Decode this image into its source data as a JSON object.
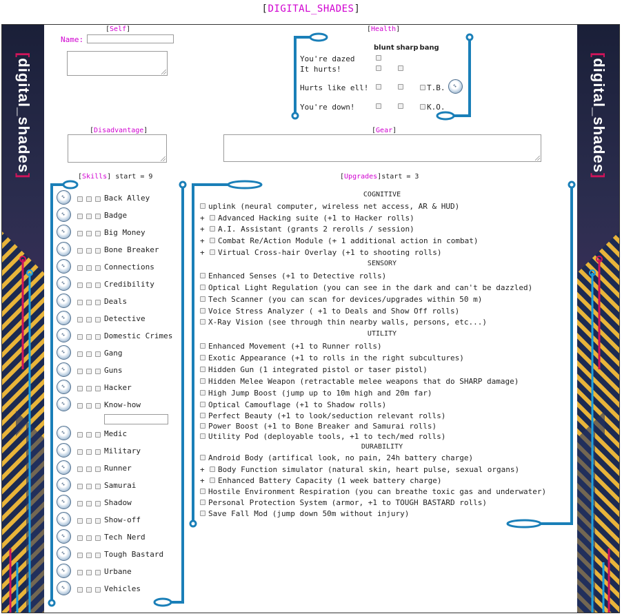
{
  "page_title": {
    "open": "[",
    "name": "DIGITAL_SHADES",
    "close": "]"
  },
  "sidebar_brand": {
    "bracket_open": "[",
    "name": "digital_shades",
    "bracket_close": "]"
  },
  "self": {
    "header": "Self",
    "name_label": "Name:"
  },
  "health": {
    "header": "Health",
    "columns": [
      "blunt",
      "sharp",
      "bang"
    ],
    "rows": [
      "You're dazed",
      "It hurts!",
      "Hurts like ell!",
      "You're down!"
    ],
    "tb_label": "T.B.",
    "ko_label": "K.O."
  },
  "disadvantage": {
    "header": "Disadvantage"
  },
  "gear": {
    "header": "Gear"
  },
  "skills": {
    "header": "Skills",
    "start_text": "start = 9",
    "items": [
      "Back Alley",
      "Badge",
      "Big Money",
      "Bone Breaker",
      "Connections",
      "Credibility",
      "Deals",
      "Detective",
      "Domestic Crimes",
      "Gang",
      "Guns",
      "Hacker",
      "Know-how",
      "Medic",
      "Military",
      "Runner",
      "Samurai",
      "Shadow",
      "Show-off",
      "Tech Nerd",
      "Tough Bastard",
      "Urbane",
      "Vehicles"
    ]
  },
  "upgrades": {
    "header": "Upgrades",
    "start_text": "start = 3",
    "categories": {
      "cognitive": "COGNITIVE",
      "sensory": "SENSORY",
      "utility": "UTILITY",
      "durability": "DURABILITY"
    },
    "plus": "+",
    "cognitive_items": [
      "uplink (neural computer, wireless net access, AR & HUD)",
      "Advanced Hacking suite (+1 to Hacker rolls)",
      "A.I. Assistant (grants 2 rerolls / session)",
      "Combat Re/Action Module (+ 1 additional action in combat)",
      "Virtual Cross-hair Overlay (+1 to shooting rolls)"
    ],
    "sensory_items": [
      "Enhanced Senses (+1 to Detective rolls)",
      "Optical Light Regulation (you can see in the dark and can't be dazzled)",
      "Tech Scanner (you can scan for devices/upgrades within 50 m)",
      "Voice Stress Analyzer ( +1 to Deals and Show Off rolls)",
      "X-Ray Vision (see through thin nearby walls, persons, etc...)"
    ],
    "utility_items": [
      "Enhanced Movement (+1 to Runner rolls)",
      "Exotic Appearance (+1 to rolls in the right subcultures)",
      "Hidden Gun (1 integrated pistol or taser pistol)",
      "Hidden Melee Weapon (retractable melee weapons that do SHARP damage)",
      "High Jump Boost (jump up to 10m high and 20m far)",
      "Optical Camouflage (+1 to Shadow rolls)",
      "Perfect Beauty (+1 to look/seduction relevant rolls)",
      "Power Boost (+1 to Bone Breaker and Samurai rolls)",
      "Utility Pod (deployable tools, +1 to tech/med rolls)"
    ],
    "durability_items": [
      "Android Body (artifical look, no pain, 24h battery charge)",
      "Body Function simulator (natural skin, heart pulse, sexual organs)",
      "Enhanced Battery Capacity (1 week battery charge)",
      "Hostile Environment Respiration (you can breathe toxic gas and underwater)",
      "Personal Protection System (armor, +1 to TOUGH BASTARD rolls)",
      "Save Fall Mod (jump down 50m without injury)"
    ]
  },
  "colors": {
    "accent": "#d000d0",
    "circuit": "#1a7fb8",
    "brand_red": "#d0145a",
    "stripe_yellow": "#e8b43a",
    "stripe_navy": "#1c2a52"
  }
}
